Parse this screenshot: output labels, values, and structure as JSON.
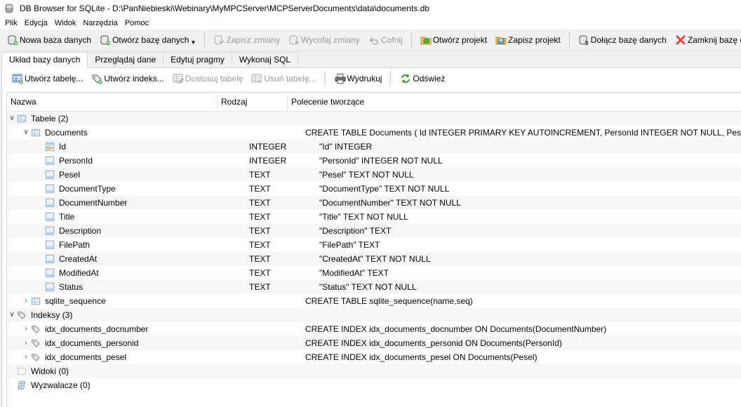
{
  "window": {
    "title": "DB Browser for SQLite - D:\\PanNiebieski\\Webinary\\MyMPCServer\\MCPServerDocuments\\data\\documents.db"
  },
  "menu": [
    "Plik",
    "Edycja",
    "Widok",
    "Narzędzia",
    "Pomoc"
  ],
  "toolbar": {
    "new_db": "Nowa baza danych",
    "open_db": "Otwórz bazę danych",
    "save_changes": "Zapisz zmiany",
    "revert_changes": "Wycofaj zmiany",
    "undo": "Cofnij",
    "open_project": "Otwórz projekt",
    "save_project": "Zapisz projekt",
    "attach_db": "Dołącz bazę danych",
    "close_db": "Zamknij bazę danych"
  },
  "tabs": [
    "Układ bazy danych",
    "Przeglądaj dane",
    "Edytuj pragmy",
    "Wykonaj SQL"
  ],
  "subtoolbar": {
    "create_table": "Utwórz tabelę...",
    "create_index": "Utwórz indeks...",
    "modify_table": "Dostosuj tabelę",
    "delete_table": "Usuń tabelę...",
    "print": "Wydrukuj",
    "refresh": "Odśwież"
  },
  "tree": {
    "headers": {
      "name": "Nazwa",
      "type": "Rodzaj",
      "sql": "Polecenie tworzące"
    },
    "rows": [
      {
        "name": "Tabele (2)",
        "type": "",
        "sql": ""
      },
      {
        "name": "Documents",
        "type": "",
        "sql": "CREATE TABLE Documents ( Id INTEGER PRIMARY KEY AUTOINCREMENT, PersonId INTEGER NOT NULL, Pesel TE"
      },
      {
        "name": "Id",
        "type": "INTEGER",
        "sql": "\"Id\" INTEGER"
      },
      {
        "name": "PersonId",
        "type": "INTEGER",
        "sql": "\"PersonId\" INTEGER NOT NULL"
      },
      {
        "name": "Pesel",
        "type": "TEXT",
        "sql": "\"Pesel\" TEXT NOT NULL"
      },
      {
        "name": "DocumentType",
        "type": "TEXT",
        "sql": "\"DocumentType\" TEXT NOT NULL"
      },
      {
        "name": "DocumentNumber",
        "type": "TEXT",
        "sql": "\"DocumentNumber\" TEXT NOT NULL"
      },
      {
        "name": "Title",
        "type": "TEXT",
        "sql": "\"Title\" TEXT NOT NULL"
      },
      {
        "name": "Description",
        "type": "TEXT",
        "sql": "\"Description\" TEXT"
      },
      {
        "name": "FilePath",
        "type": "TEXT",
        "sql": "\"FilePath\" TEXT"
      },
      {
        "name": "CreatedAt",
        "type": "TEXT",
        "sql": "\"CreatedAt\" TEXT NOT NULL"
      },
      {
        "name": "ModifiedAt",
        "type": "TEXT",
        "sql": "\"ModifiedAt\" TEXT"
      },
      {
        "name": "Status",
        "type": "TEXT",
        "sql": "\"Status\" TEXT NOT NULL"
      },
      {
        "name": "sqlite_sequence",
        "type": "",
        "sql": "CREATE TABLE sqlite_sequence(name,seq)"
      },
      {
        "name": "Indeksy (3)",
        "type": "",
        "sql": ""
      },
      {
        "name": "idx_documents_docnumber",
        "type": "",
        "sql": "CREATE INDEX idx_documents_docnumber ON Documents(DocumentNumber)"
      },
      {
        "name": "idx_documents_personid",
        "type": "",
        "sql": "CREATE INDEX idx_documents_personid ON Documents(PersonId)"
      },
      {
        "name": "idx_documents_pesel",
        "type": "",
        "sql": "CREATE INDEX idx_documents_pesel ON Documents(Pesel)"
      },
      {
        "name": "Widoki (0)",
        "type": "",
        "sql": ""
      },
      {
        "name": "Wyzwalacze (0)",
        "type": "",
        "sql": ""
      }
    ]
  },
  "colors": {
    "row_alt": "#f7f7f7",
    "close_red": "#e0443e",
    "accent_blue": "#3b7ddd"
  }
}
